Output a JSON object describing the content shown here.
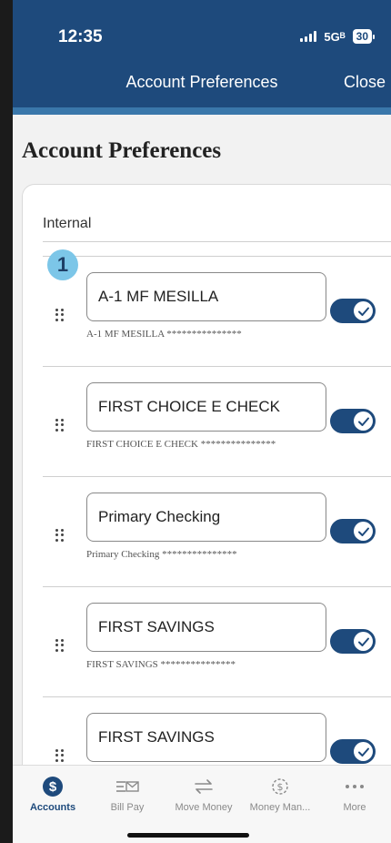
{
  "status_bar": {
    "time": "12:35",
    "network": "5Gᴮ",
    "battery": "30"
  },
  "nav": {
    "title": "Account Preferences",
    "close_label": "Close"
  },
  "page": {
    "title": "Account Preferences",
    "section_label": "Internal"
  },
  "badge": "1",
  "accounts": [
    {
      "name": "A-1 MF MESILLA",
      "subtitle": "A-1 MF MESILLA ***************",
      "enabled": true
    },
    {
      "name": "FIRST CHOICE E CHECK",
      "subtitle": "FIRST CHOICE E CHECK ***************",
      "enabled": true
    },
    {
      "name": "Primary Checking",
      "subtitle": "Primary Checking  ***************",
      "enabled": true
    },
    {
      "name": "FIRST SAVINGS",
      "subtitle": "FIRST SAVINGS ***************",
      "enabled": true
    },
    {
      "name": "FIRST SAVINGS",
      "subtitle": "",
      "enabled": true
    }
  ],
  "tabs": [
    {
      "label": "Accounts",
      "icon": "dollar-circle-icon",
      "active": true
    },
    {
      "label": "Bill Pay",
      "icon": "bill-pay-icon",
      "active": false
    },
    {
      "label": "Move Money",
      "icon": "transfer-arrows-icon",
      "active": false
    },
    {
      "label": "Money Man...",
      "icon": "money-manager-icon",
      "active": false
    },
    {
      "label": "More",
      "icon": "more-dots-icon",
      "active": false
    }
  ],
  "colors": {
    "brand": "#1e4a7c",
    "accent": "#3a77aa",
    "badge": "#7cc6e8"
  }
}
